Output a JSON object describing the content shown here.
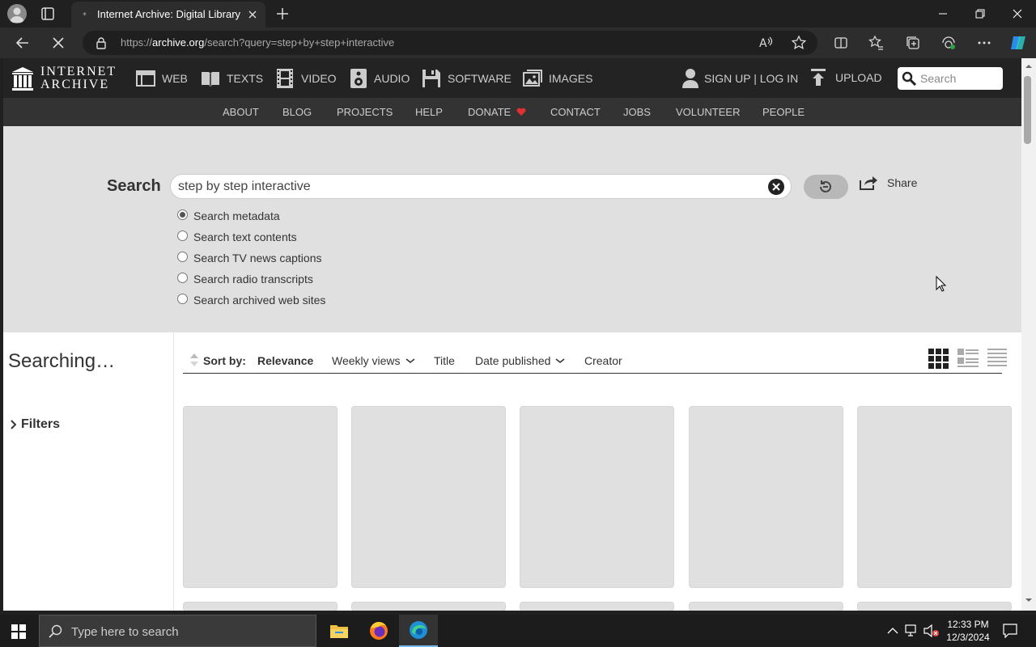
{
  "browser": {
    "tab_title": "Internet Archive: Digital Library of Free & Borrowable Books, Movies, Music & Wayback Machine",
    "tab_favicon": "*",
    "url_prefix": "https://",
    "url_host": "archive.org",
    "url_path": "/search?query=step+by+step+interactive"
  },
  "ia_header": {
    "logo_line1": "INTERNET",
    "logo_line2": "ARCHIVE",
    "media_links": [
      {
        "label": "WEB",
        "icon": "web-icon"
      },
      {
        "label": "TEXTS",
        "icon": "book-icon"
      },
      {
        "label": "VIDEO",
        "icon": "film-icon"
      },
      {
        "label": "AUDIO",
        "icon": "speaker-icon"
      },
      {
        "label": "SOFTWARE",
        "icon": "floppy-icon"
      },
      {
        "label": "IMAGES",
        "icon": "image-icon"
      }
    ],
    "signup_label": "SIGN UP | LOG IN",
    "upload_label": "UPLOAD",
    "search_placeholder": "Search"
  },
  "ia_subnav": [
    "ABOUT",
    "BLOG",
    "PROJECTS",
    "HELP",
    "DONATE",
    "CONTACT",
    "JOBS",
    "VOLUNTEER",
    "PEOPLE"
  ],
  "search": {
    "label": "Search",
    "query": "step by step interactive",
    "share_label": "Share",
    "options": [
      {
        "label": "Search metadata",
        "selected": true
      },
      {
        "label": "Search text contents",
        "selected": false
      },
      {
        "label": "Search TV news captions",
        "selected": false
      },
      {
        "label": "Search radio transcripts",
        "selected": false
      },
      {
        "label": "Search archived web sites",
        "selected": false
      }
    ]
  },
  "results": {
    "status": "Searching…",
    "filters_label": "Filters",
    "sort_by_label": "Sort by:",
    "sort_options": [
      "Relevance",
      "Weekly views",
      "Title",
      "Date published",
      "Creator"
    ],
    "active_sort": "Relevance"
  },
  "taskbar": {
    "search_placeholder": "Type here to search",
    "time": "12:33 PM",
    "date": "12/3/2024"
  },
  "colors": {
    "ia_header_bg": "#232323",
    "ia_subnav_bg": "#333333",
    "search_panel_bg": "#e0e0e0",
    "donate_heart": "#e03030",
    "placeholder_tile": "#e0e0e0"
  }
}
